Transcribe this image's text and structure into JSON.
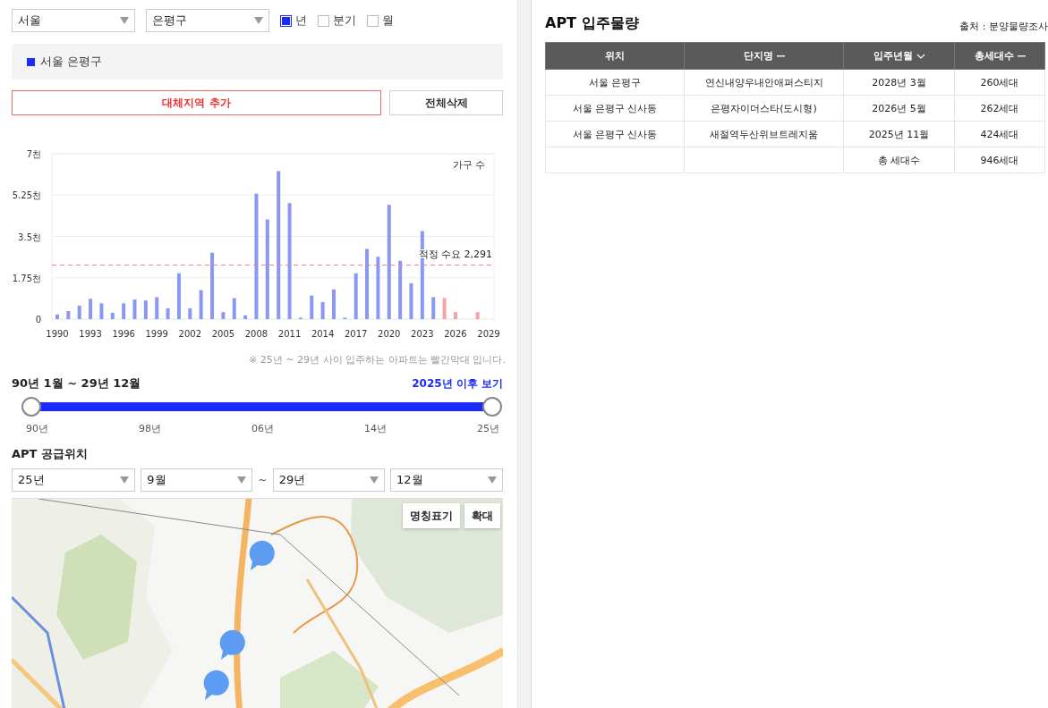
{
  "filters": {
    "city": "서울",
    "district": "은평구",
    "periods": [
      {
        "label": "년",
        "checked": true
      },
      {
        "label": "분기",
        "checked": false
      },
      {
        "label": "월",
        "checked": false
      }
    ]
  },
  "selected_regions": [
    {
      "label": "서울 은평구",
      "color": "#1a2cf5"
    }
  ],
  "actions": {
    "add": "대체지역 추가",
    "clear": "전체삭제"
  },
  "chart": {
    "chart_data": {
      "type": "bar",
      "grid": true,
      "ylabel": "가구 수",
      "categories": [
        "1990",
        null,
        null,
        "1993",
        null,
        null,
        "1996",
        null,
        null,
        "1999",
        null,
        null,
        "2002",
        null,
        null,
        "2005",
        null,
        null,
        "2008",
        null,
        null,
        "2011",
        null,
        null,
        "2014",
        null,
        null,
        "2017",
        null,
        null,
        "2020",
        null,
        null,
        "2023",
        null,
        null,
        "2026",
        null,
        null,
        "2029"
      ],
      "series": [
        {
          "color": "#8b98f3",
          "values": [
            0.2,
            0.34,
            0.57,
            0.86,
            0.67,
            0.27,
            0.67,
            0.83,
            0.79,
            0.93,
            0.46,
            1.94,
            0.46,
            1.23,
            2.81,
            0.3,
            0.89,
            0.16,
            5.31,
            4.22,
            6.27,
            4.91,
            0.06,
            1.0,
            0.72,
            1.26,
            0.06,
            1.94,
            2.97,
            2.64,
            4.84,
            2.47,
            1.52,
            3.73,
            0.93,
            null,
            null,
            null,
            null,
            null
          ]
        },
        {
          "color": "#f7a3a3",
          "values": [
            null,
            null,
            null,
            null,
            null,
            null,
            null,
            null,
            null,
            null,
            null,
            null,
            null,
            null,
            null,
            null,
            null,
            null,
            null,
            null,
            null,
            null,
            null,
            null,
            null,
            null,
            null,
            null,
            null,
            null,
            null,
            null,
            null,
            null,
            null,
            0.89,
            0.3,
            null,
            0.3,
            null
          ]
        }
      ],
      "ylim": [
        0,
        7
      ],
      "yticks": [
        {
          "value": 0,
          "label": "0"
        },
        {
          "value": 1.75,
          "label": "1.75천"
        },
        {
          "value": 3.5,
          "label": "3.5천"
        },
        {
          "value": 5.25,
          "label": "5.25천"
        },
        {
          "value": 7,
          "label": "7천"
        }
      ],
      "ref_lines": [
        {
          "axis": "y",
          "value": 2.291,
          "label": "적정 수요 2,291"
        }
      ]
    },
    "note": "※ 25년 ~ 29년 사이 입주하는 아파트는 빨간막대 입니다."
  },
  "range": {
    "label": "90년 1월 ~ 29년 12월",
    "link": "2025년 이후 보기",
    "level": 1,
    "ticks": [
      "90년",
      "98년",
      "06년",
      "14년",
      "25년"
    ]
  },
  "supply": {
    "title": "APT 공급위치",
    "selects": [
      "25년",
      "9월",
      "29년",
      "12월"
    ],
    "separator": "~",
    "map": {
      "kind": "picture",
      "buttons": [
        "명칭표기",
        "확대"
      ]
    }
  },
  "table": {
    "title": "APT 입주물량",
    "source": "출처 : 분양물량조사",
    "columns": [
      {
        "label": "위치",
        "kind": "plain"
      },
      {
        "label": "단지명",
        "kind": "sortable"
      },
      {
        "label": "입주년월",
        "kind": "sorted"
      },
      {
        "label": "총세대수",
        "kind": "sortable"
      }
    ],
    "rows": [
      [
        "서울 은평구",
        "연신내양우내안애퍼스티지",
        "2028년 3월",
        "260세대"
      ],
      [
        "서울 은평구 신사동",
        "은평자이더스타(도시형)",
        "2026년 5월",
        "262세대"
      ],
      [
        "서울 은평구 신사동",
        "새절역두산위브트레지움",
        "2025년 11월",
        "424세대"
      ]
    ],
    "total": {
      "label": "총 세대수",
      "value": "946세대"
    }
  }
}
